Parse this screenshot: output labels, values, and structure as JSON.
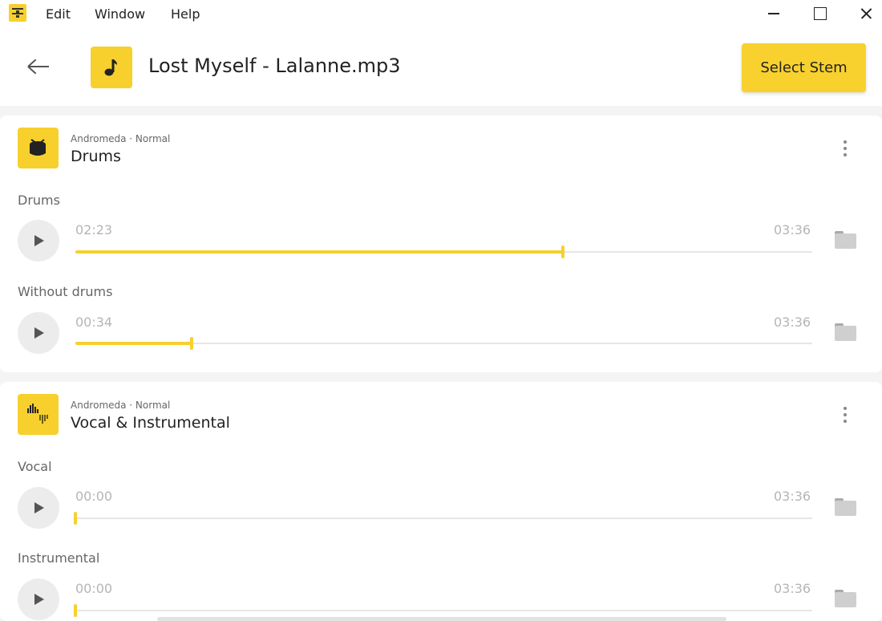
{
  "menubar": {
    "items": [
      {
        "label": "Edit"
      },
      {
        "label": "Window"
      },
      {
        "label": "Help"
      }
    ]
  },
  "header": {
    "file_name": "Lost Myself - Lalanne.mp3",
    "select_stem_label": "Select Stem"
  },
  "cards": [
    {
      "subtitle": "Andromeda · Normal",
      "title": "Drums",
      "icon": "drum-icon",
      "tracks": [
        {
          "label": "Drums",
          "current": "02:23",
          "total": "03:36",
          "progress": 0.6616
        },
        {
          "label": "Without drums",
          "current": "00:34",
          "total": "03:36",
          "progress": 0.1574
        }
      ]
    },
    {
      "subtitle": "Andromeda · Normal",
      "title": "Vocal & Instrumental",
      "icon": "waveform-icon",
      "tracks": [
        {
          "label": "Vocal",
          "current": "00:00",
          "total": "03:36",
          "progress": 0
        },
        {
          "label": "Instrumental",
          "current": "00:00",
          "total": "03:36",
          "progress": 0
        }
      ]
    }
  ],
  "colors": {
    "accent": "#f7d02d",
    "background": "#f4f4f4",
    "card": "#ffffff",
    "muted_text": "#666666",
    "time_text": "#b5b5b5"
  }
}
